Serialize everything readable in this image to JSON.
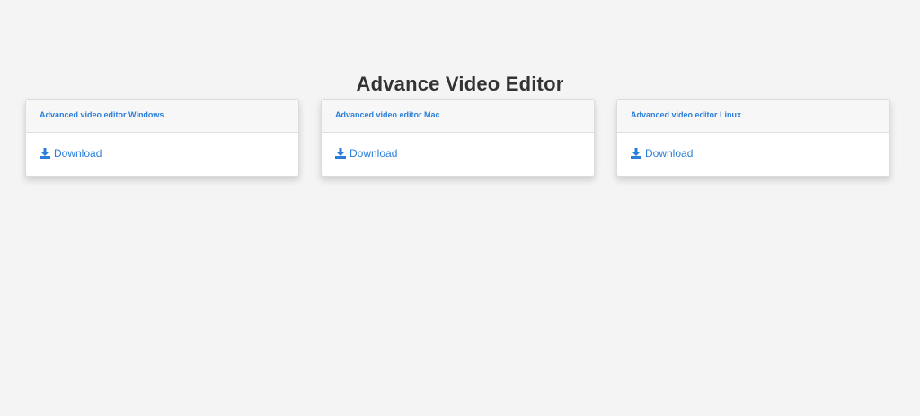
{
  "page": {
    "title": "Advance Video Editor"
  },
  "cards": [
    {
      "title": "Advanced video editor Windows",
      "link_label": "Download",
      "icon": "download-icon"
    },
    {
      "title": "Advanced video editor Mac",
      "link_label": "Download",
      "icon": "download-icon"
    },
    {
      "title": "Advanced video editor Linux",
      "link_label": "Download",
      "icon": "download-icon"
    }
  ],
  "colors": {
    "background": "#f4f4f4",
    "accent": "#2a7ed8",
    "title": "#333333"
  }
}
